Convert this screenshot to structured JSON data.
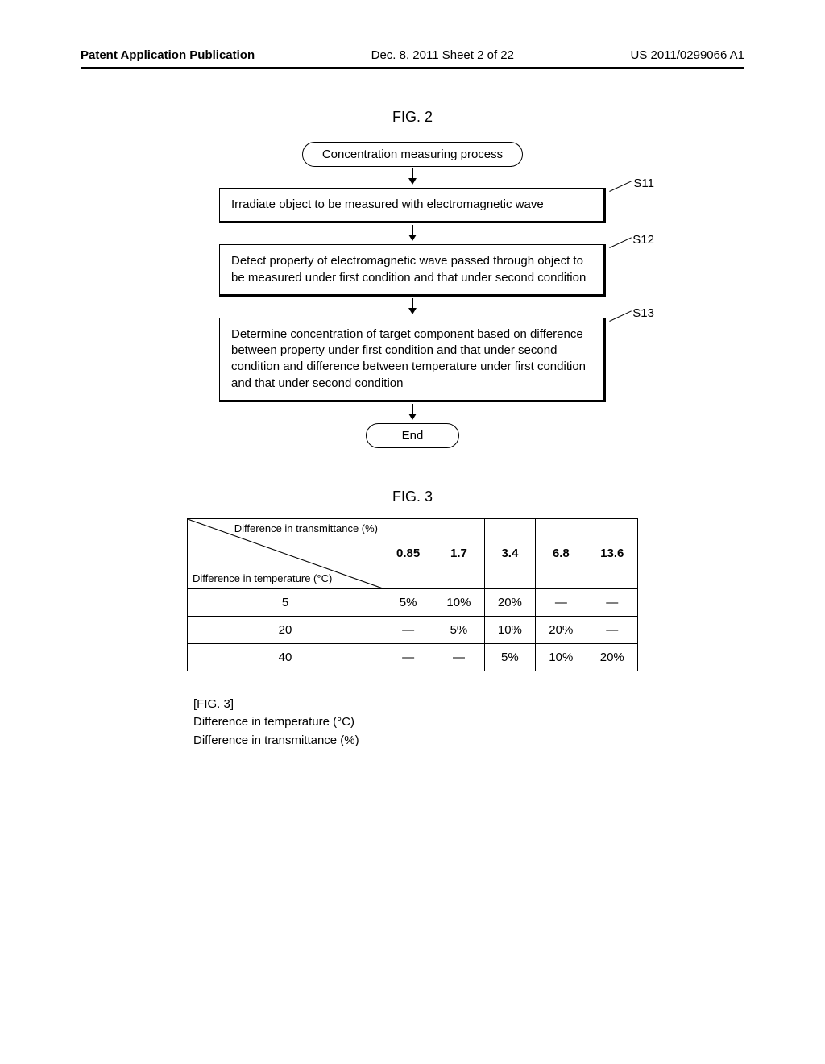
{
  "header": {
    "left": "Patent Application Publication",
    "center": "Dec. 8, 2011   Sheet 2 of 22",
    "right": "US 2011/0299066 A1"
  },
  "fig2": {
    "label": "FIG. 2",
    "start": "Concentration measuring process",
    "steps": [
      {
        "tag": "S11",
        "text": "Irradiate object to be measured with electromagnetic wave"
      },
      {
        "tag": "S12",
        "text": "Detect property of electromagnetic wave passed through object to be measured under first condition and that under second condition"
      },
      {
        "tag": "S13",
        "text": "Determine concentration of target component based on difference between property under first condition and that under second condition and difference between temperature under first condition and that under second condition"
      }
    ],
    "end": "End"
  },
  "fig3": {
    "label": "FIG. 3",
    "diag_top": "Difference in transmittance (%)",
    "diag_bottom": "Difference in temperature (°C)",
    "col_headers": [
      "0.85",
      "1.7",
      "3.4",
      "6.8",
      "13.6"
    ],
    "rows": [
      {
        "label": "5",
        "cells": [
          "5%",
          "10%",
          "20%",
          "—",
          "—"
        ]
      },
      {
        "label": "20",
        "cells": [
          "—",
          "5%",
          "10%",
          "20%",
          "—"
        ]
      },
      {
        "label": "40",
        "cells": [
          "—",
          "—",
          "5%",
          "10%",
          "20%"
        ]
      }
    ],
    "footnote_title": "[FIG. 3]",
    "footnote_line1": "Difference in temperature (°C)",
    "footnote_line2": "Difference in transmittance (%)"
  }
}
